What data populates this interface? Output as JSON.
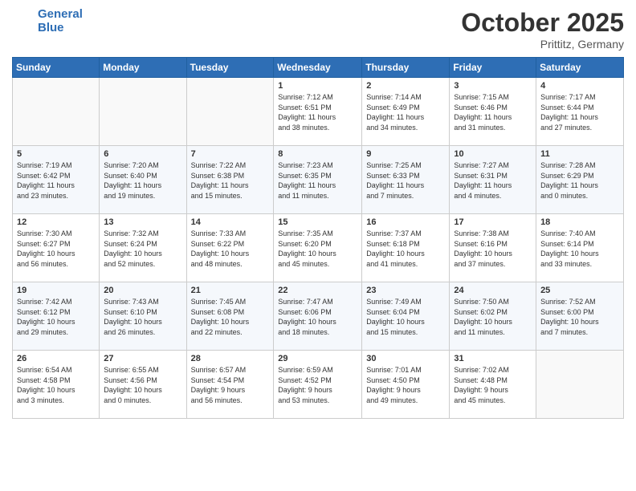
{
  "header": {
    "logo_line1": "General",
    "logo_line2": "Blue",
    "month": "October 2025",
    "location": "Prittitz, Germany"
  },
  "days_of_week": [
    "Sunday",
    "Monday",
    "Tuesday",
    "Wednesday",
    "Thursday",
    "Friday",
    "Saturday"
  ],
  "weeks": [
    [
      {
        "day": "",
        "info": ""
      },
      {
        "day": "",
        "info": ""
      },
      {
        "day": "",
        "info": ""
      },
      {
        "day": "1",
        "info": "Sunrise: 7:12 AM\nSunset: 6:51 PM\nDaylight: 11 hours\nand 38 minutes."
      },
      {
        "day": "2",
        "info": "Sunrise: 7:14 AM\nSunset: 6:49 PM\nDaylight: 11 hours\nand 34 minutes."
      },
      {
        "day": "3",
        "info": "Sunrise: 7:15 AM\nSunset: 6:46 PM\nDaylight: 11 hours\nand 31 minutes."
      },
      {
        "day": "4",
        "info": "Sunrise: 7:17 AM\nSunset: 6:44 PM\nDaylight: 11 hours\nand 27 minutes."
      }
    ],
    [
      {
        "day": "5",
        "info": "Sunrise: 7:19 AM\nSunset: 6:42 PM\nDaylight: 11 hours\nand 23 minutes."
      },
      {
        "day": "6",
        "info": "Sunrise: 7:20 AM\nSunset: 6:40 PM\nDaylight: 11 hours\nand 19 minutes."
      },
      {
        "day": "7",
        "info": "Sunrise: 7:22 AM\nSunset: 6:38 PM\nDaylight: 11 hours\nand 15 minutes."
      },
      {
        "day": "8",
        "info": "Sunrise: 7:23 AM\nSunset: 6:35 PM\nDaylight: 11 hours\nand 11 minutes."
      },
      {
        "day": "9",
        "info": "Sunrise: 7:25 AM\nSunset: 6:33 PM\nDaylight: 11 hours\nand 7 minutes."
      },
      {
        "day": "10",
        "info": "Sunrise: 7:27 AM\nSunset: 6:31 PM\nDaylight: 11 hours\nand 4 minutes."
      },
      {
        "day": "11",
        "info": "Sunrise: 7:28 AM\nSunset: 6:29 PM\nDaylight: 11 hours\nand 0 minutes."
      }
    ],
    [
      {
        "day": "12",
        "info": "Sunrise: 7:30 AM\nSunset: 6:27 PM\nDaylight: 10 hours\nand 56 minutes."
      },
      {
        "day": "13",
        "info": "Sunrise: 7:32 AM\nSunset: 6:24 PM\nDaylight: 10 hours\nand 52 minutes."
      },
      {
        "day": "14",
        "info": "Sunrise: 7:33 AM\nSunset: 6:22 PM\nDaylight: 10 hours\nand 48 minutes."
      },
      {
        "day": "15",
        "info": "Sunrise: 7:35 AM\nSunset: 6:20 PM\nDaylight: 10 hours\nand 45 minutes."
      },
      {
        "day": "16",
        "info": "Sunrise: 7:37 AM\nSunset: 6:18 PM\nDaylight: 10 hours\nand 41 minutes."
      },
      {
        "day": "17",
        "info": "Sunrise: 7:38 AM\nSunset: 6:16 PM\nDaylight: 10 hours\nand 37 minutes."
      },
      {
        "day": "18",
        "info": "Sunrise: 7:40 AM\nSunset: 6:14 PM\nDaylight: 10 hours\nand 33 minutes."
      }
    ],
    [
      {
        "day": "19",
        "info": "Sunrise: 7:42 AM\nSunset: 6:12 PM\nDaylight: 10 hours\nand 29 minutes."
      },
      {
        "day": "20",
        "info": "Sunrise: 7:43 AM\nSunset: 6:10 PM\nDaylight: 10 hours\nand 26 minutes."
      },
      {
        "day": "21",
        "info": "Sunrise: 7:45 AM\nSunset: 6:08 PM\nDaylight: 10 hours\nand 22 minutes."
      },
      {
        "day": "22",
        "info": "Sunrise: 7:47 AM\nSunset: 6:06 PM\nDaylight: 10 hours\nand 18 minutes."
      },
      {
        "day": "23",
        "info": "Sunrise: 7:49 AM\nSunset: 6:04 PM\nDaylight: 10 hours\nand 15 minutes."
      },
      {
        "day": "24",
        "info": "Sunrise: 7:50 AM\nSunset: 6:02 PM\nDaylight: 10 hours\nand 11 minutes."
      },
      {
        "day": "25",
        "info": "Sunrise: 7:52 AM\nSunset: 6:00 PM\nDaylight: 10 hours\nand 7 minutes."
      }
    ],
    [
      {
        "day": "26",
        "info": "Sunrise: 6:54 AM\nSunset: 4:58 PM\nDaylight: 10 hours\nand 3 minutes."
      },
      {
        "day": "27",
        "info": "Sunrise: 6:55 AM\nSunset: 4:56 PM\nDaylight: 10 hours\nand 0 minutes."
      },
      {
        "day": "28",
        "info": "Sunrise: 6:57 AM\nSunset: 4:54 PM\nDaylight: 9 hours\nand 56 minutes."
      },
      {
        "day": "29",
        "info": "Sunrise: 6:59 AM\nSunset: 4:52 PM\nDaylight: 9 hours\nand 53 minutes."
      },
      {
        "day": "30",
        "info": "Sunrise: 7:01 AM\nSunset: 4:50 PM\nDaylight: 9 hours\nand 49 minutes."
      },
      {
        "day": "31",
        "info": "Sunrise: 7:02 AM\nSunset: 4:48 PM\nDaylight: 9 hours\nand 45 minutes."
      },
      {
        "day": "",
        "info": ""
      }
    ]
  ]
}
